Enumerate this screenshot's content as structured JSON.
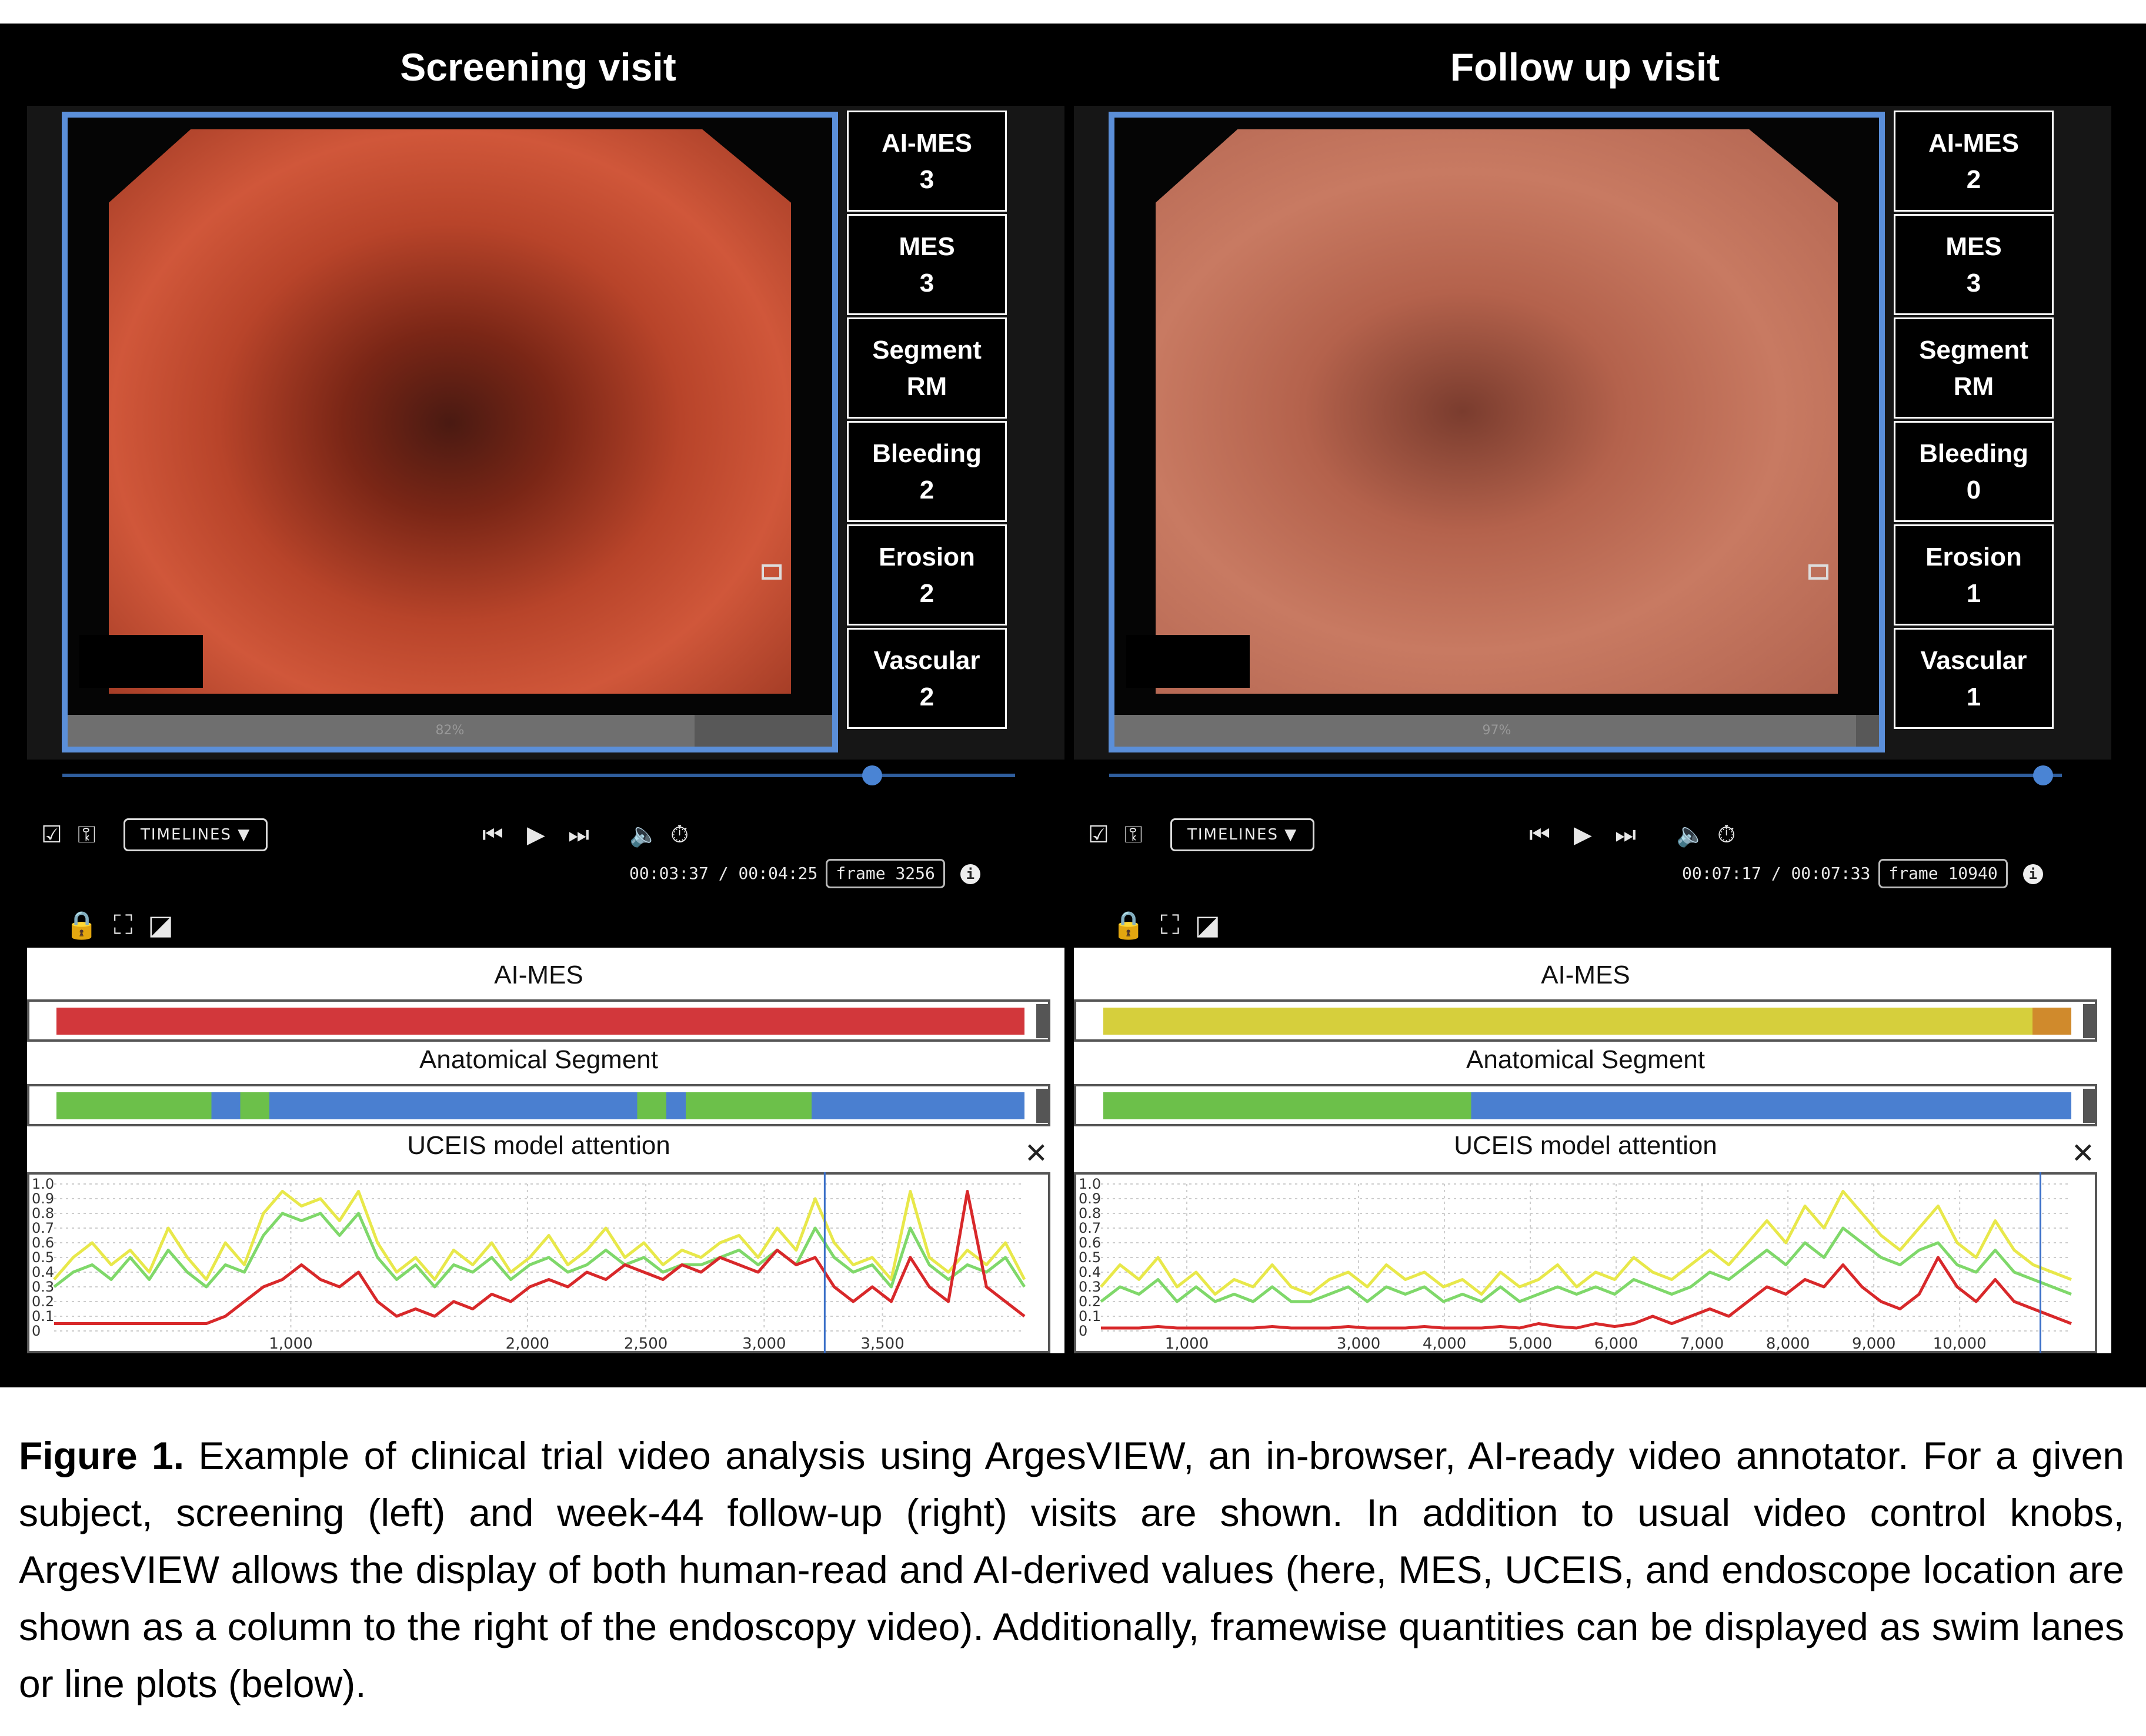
{
  "panels": [
    {
      "title": "Screening visit",
      "scores": [
        {
          "label": "AI-MES",
          "value": "3"
        },
        {
          "label": "MES",
          "value": "3"
        },
        {
          "label": "Segment",
          "value": "RM"
        },
        {
          "label": "Bleeding",
          "value": "2"
        },
        {
          "label": "Erosion",
          "value": "2"
        },
        {
          "label": "Vascular",
          "value": "2"
        }
      ],
      "progress_text": "82%",
      "progress_fraction": 0.82,
      "scrubber_fraction": 0.85,
      "controls": {
        "timelines_label": "TIMELINES",
        "current_time": "00:03:37",
        "total_time": "00:04:25",
        "frame": "frame 3256"
      },
      "lanes": {
        "ai_mes_title": "AI-MES",
        "segment_title": "Anatomical Segment",
        "attention_title": "UCEIS model attention"
      },
      "ai_mes_color": "#d2373b",
      "chart_data": {
        "type": "line",
        "title": "UCEIS model attention",
        "ylim": [
          0,
          1.0
        ],
        "y_ticks": [
          "1.0",
          "0.9",
          "0.8",
          "0.7",
          "0.6",
          "0.5",
          "0.4",
          "0.3",
          "0.2",
          "0.1",
          "0"
        ],
        "x_ticks": [
          "1,000",
          "2,000",
          "2,500",
          "3,000",
          "3,500"
        ],
        "x_tick_values": [
          1000,
          2000,
          2500,
          3000,
          3500
        ],
        "xlim": [
          0,
          4100
        ],
        "cursor_x": 3256,
        "series": [
          {
            "color": "#e8e84a",
            "values": [
              0.35,
              0.5,
              0.6,
              0.45,
              0.55,
              0.4,
              0.7,
              0.5,
              0.35,
              0.6,
              0.45,
              0.8,
              0.95,
              0.85,
              0.9,
              0.75,
              0.95,
              0.6,
              0.4,
              0.5,
              0.35,
              0.55,
              0.45,
              0.6,
              0.4,
              0.5,
              0.65,
              0.45,
              0.55,
              0.7,
              0.5,
              0.6,
              0.45,
              0.55,
              0.5,
              0.6,
              0.65,
              0.5,
              0.7,
              0.55,
              0.9,
              0.6,
              0.45,
              0.5,
              0.35,
              0.95,
              0.5,
              0.4,
              0.55,
              0.45,
              0.6,
              0.35
            ]
          },
          {
            "color": "#7fd86a",
            "values": [
              0.3,
              0.4,
              0.45,
              0.35,
              0.5,
              0.35,
              0.55,
              0.4,
              0.3,
              0.45,
              0.4,
              0.65,
              0.8,
              0.75,
              0.8,
              0.65,
              0.8,
              0.5,
              0.35,
              0.45,
              0.3,
              0.45,
              0.4,
              0.5,
              0.35,
              0.45,
              0.5,
              0.4,
              0.45,
              0.55,
              0.45,
              0.5,
              0.4,
              0.45,
              0.45,
              0.5,
              0.55,
              0.45,
              0.55,
              0.45,
              0.7,
              0.5,
              0.4,
              0.45,
              0.3,
              0.7,
              0.45,
              0.35,
              0.45,
              0.4,
              0.5,
              0.3
            ]
          },
          {
            "color": "#d8282a",
            "values": [
              0.05,
              0.05,
              0.05,
              0.05,
              0.05,
              0.05,
              0.05,
              0.05,
              0.05,
              0.1,
              0.2,
              0.3,
              0.35,
              0.45,
              0.35,
              0.3,
              0.4,
              0.2,
              0.1,
              0.15,
              0.1,
              0.2,
              0.15,
              0.25,
              0.2,
              0.3,
              0.35,
              0.3,
              0.4,
              0.35,
              0.45,
              0.4,
              0.35,
              0.45,
              0.4,
              0.5,
              0.45,
              0.4,
              0.55,
              0.45,
              0.5,
              0.3,
              0.2,
              0.3,
              0.2,
              0.5,
              0.3,
              0.2,
              0.95,
              0.3,
              0.2,
              0.1
            ]
          }
        ]
      }
    },
    {
      "title": "Follow up visit",
      "scores": [
        {
          "label": "AI-MES",
          "value": "2"
        },
        {
          "label": "MES",
          "value": "3"
        },
        {
          "label": "Segment",
          "value": "RM"
        },
        {
          "label": "Bleeding",
          "value": "0"
        },
        {
          "label": "Erosion",
          "value": "1"
        },
        {
          "label": "Vascular",
          "value": "1"
        }
      ],
      "progress_text": "97%",
      "progress_fraction": 0.97,
      "scrubber_fraction": 0.98,
      "controls": {
        "timelines_label": "TIMELINES",
        "current_time": "00:07:17",
        "total_time": "00:07:33",
        "frame": "frame 10940"
      },
      "lanes": {
        "ai_mes_title": "AI-MES",
        "segment_title": "Anatomical Segment",
        "attention_title": "UCEIS model attention"
      },
      "ai_mes_color": "#d6cf3c",
      "chart_data": {
        "type": "line",
        "title": "UCEIS model attention",
        "ylim": [
          0,
          1.0
        ],
        "y_ticks": [
          "1.0",
          "0.9",
          "0.8",
          "0.7",
          "0.6",
          "0.5",
          "0.4",
          "0.3",
          "0.2",
          "0.1",
          "0"
        ],
        "x_ticks": [
          "1,000",
          "3,000",
          "4,000",
          "5,000",
          "6,000",
          "7,000",
          "8,000",
          "9,000",
          "10,000"
        ],
        "x_tick_values": [
          1000,
          3000,
          4000,
          5000,
          6000,
          7000,
          8000,
          9000,
          10000
        ],
        "xlim": [
          0,
          11300
        ],
        "cursor_x": 10940,
        "series": [
          {
            "color": "#e8e84a",
            "values": [
              0.3,
              0.45,
              0.35,
              0.5,
              0.3,
              0.4,
              0.25,
              0.35,
              0.3,
              0.45,
              0.3,
              0.25,
              0.35,
              0.4,
              0.3,
              0.45,
              0.35,
              0.4,
              0.3,
              0.35,
              0.25,
              0.4,
              0.3,
              0.35,
              0.45,
              0.3,
              0.4,
              0.35,
              0.5,
              0.4,
              0.35,
              0.45,
              0.55,
              0.45,
              0.6,
              0.75,
              0.6,
              0.85,
              0.7,
              0.95,
              0.8,
              0.65,
              0.55,
              0.7,
              0.85,
              0.6,
              0.5,
              0.75,
              0.55,
              0.45,
              0.4,
              0.35
            ]
          },
          {
            "color": "#7fd86a",
            "values": [
              0.2,
              0.3,
              0.25,
              0.35,
              0.2,
              0.3,
              0.2,
              0.25,
              0.2,
              0.3,
              0.2,
              0.2,
              0.25,
              0.3,
              0.2,
              0.3,
              0.25,
              0.3,
              0.2,
              0.25,
              0.2,
              0.3,
              0.2,
              0.25,
              0.3,
              0.25,
              0.3,
              0.25,
              0.35,
              0.3,
              0.25,
              0.3,
              0.4,
              0.35,
              0.45,
              0.55,
              0.45,
              0.6,
              0.5,
              0.7,
              0.6,
              0.5,
              0.45,
              0.55,
              0.6,
              0.45,
              0.4,
              0.55,
              0.4,
              0.35,
              0.3,
              0.25
            ]
          },
          {
            "color": "#d8282a",
            "values": [
              0.02,
              0.02,
              0.02,
              0.03,
              0.02,
              0.02,
              0.02,
              0.02,
              0.02,
              0.03,
              0.02,
              0.02,
              0.02,
              0.03,
              0.02,
              0.02,
              0.02,
              0.03,
              0.02,
              0.02,
              0.02,
              0.03,
              0.02,
              0.05,
              0.03,
              0.02,
              0.05,
              0.03,
              0.05,
              0.1,
              0.05,
              0.1,
              0.15,
              0.1,
              0.2,
              0.3,
              0.25,
              0.35,
              0.3,
              0.45,
              0.3,
              0.2,
              0.15,
              0.25,
              0.5,
              0.3,
              0.2,
              0.35,
              0.2,
              0.15,
              0.1,
              0.05
            ]
          }
        ]
      }
    }
  ],
  "caption": {
    "label": "Figure 1.",
    "text": " Example of clinical trial video analysis using ArgesVIEW, an in-browser, AI-ready video annotator. For a given subject, screening (left) and week-44 follow-up (right) visits are shown. In addition to usual video control knobs, ArgesVIEW allows the display of both human-read and AI-derived values (here, MES, UCEIS, and endoscope location are shown as a column to the right of the endoscopy video). Additionally, framewise quantities can be displayed as swim lanes or line plots (below)."
  }
}
